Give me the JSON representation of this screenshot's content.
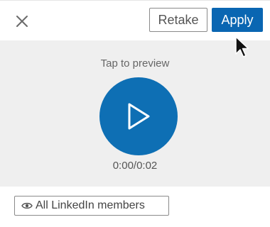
{
  "header": {
    "retake_label": "Retake",
    "apply_label": "Apply",
    "close_icon": "close-icon"
  },
  "preview": {
    "hint": "Tap to preview",
    "duration": "0:00/0:02",
    "play_icon": "play-icon"
  },
  "visibility": {
    "label": "All LinkedIn members",
    "icon": "eye-icon"
  },
  "colors": {
    "accent": "#0a66b2",
    "play_circle": "#0e6fb4",
    "preview_bg": "#efefef"
  }
}
